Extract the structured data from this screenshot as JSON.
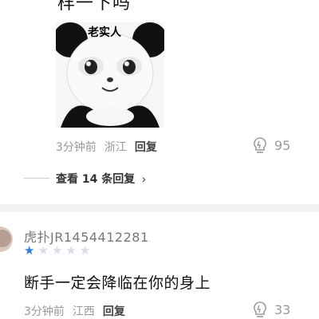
{
  "comment1": {
    "text_top": "样一下吗",
    "sticker_text": "老实人",
    "time": "3分钟前",
    "location": "浙江",
    "reply_label": "回复",
    "likes": "95",
    "view_replies": "查看 14 条回复",
    "view_replies_chevron": "›"
  },
  "comment2": {
    "username": "虎扑JR1454412281",
    "rating": 1,
    "rating_max": 5,
    "text": "断手一定会降临在你的身上",
    "time": "3分钟前",
    "location": "江西",
    "reply_label": "回复",
    "likes": "33"
  },
  "colors": {
    "star_active": "#2f7fd8",
    "star_inactive": "#d7dee6",
    "meta_gray": "#999999"
  },
  "icons": [
    "sticker-image",
    "like-bulb-icon",
    "chevron-right-icon",
    "star-icon",
    "avatar"
  ]
}
